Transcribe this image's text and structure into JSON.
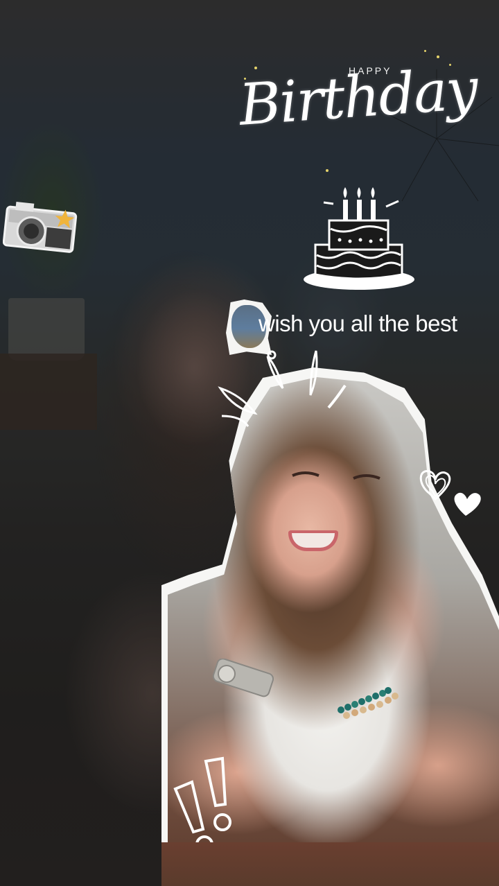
{
  "greeting": {
    "top_line": "HAPPY",
    "headline": "Birthday",
    "message": "wish you all the best"
  },
  "stickers": {
    "camera": "camera-icon",
    "cake": "birthday-cake-icon",
    "hearts": "hearts-icon",
    "exclamation": "exclamation-marks-icon"
  },
  "colors": {
    "text": "#ffffff",
    "sparkle": "#e5d36b",
    "paper": "#f6f6f4"
  }
}
